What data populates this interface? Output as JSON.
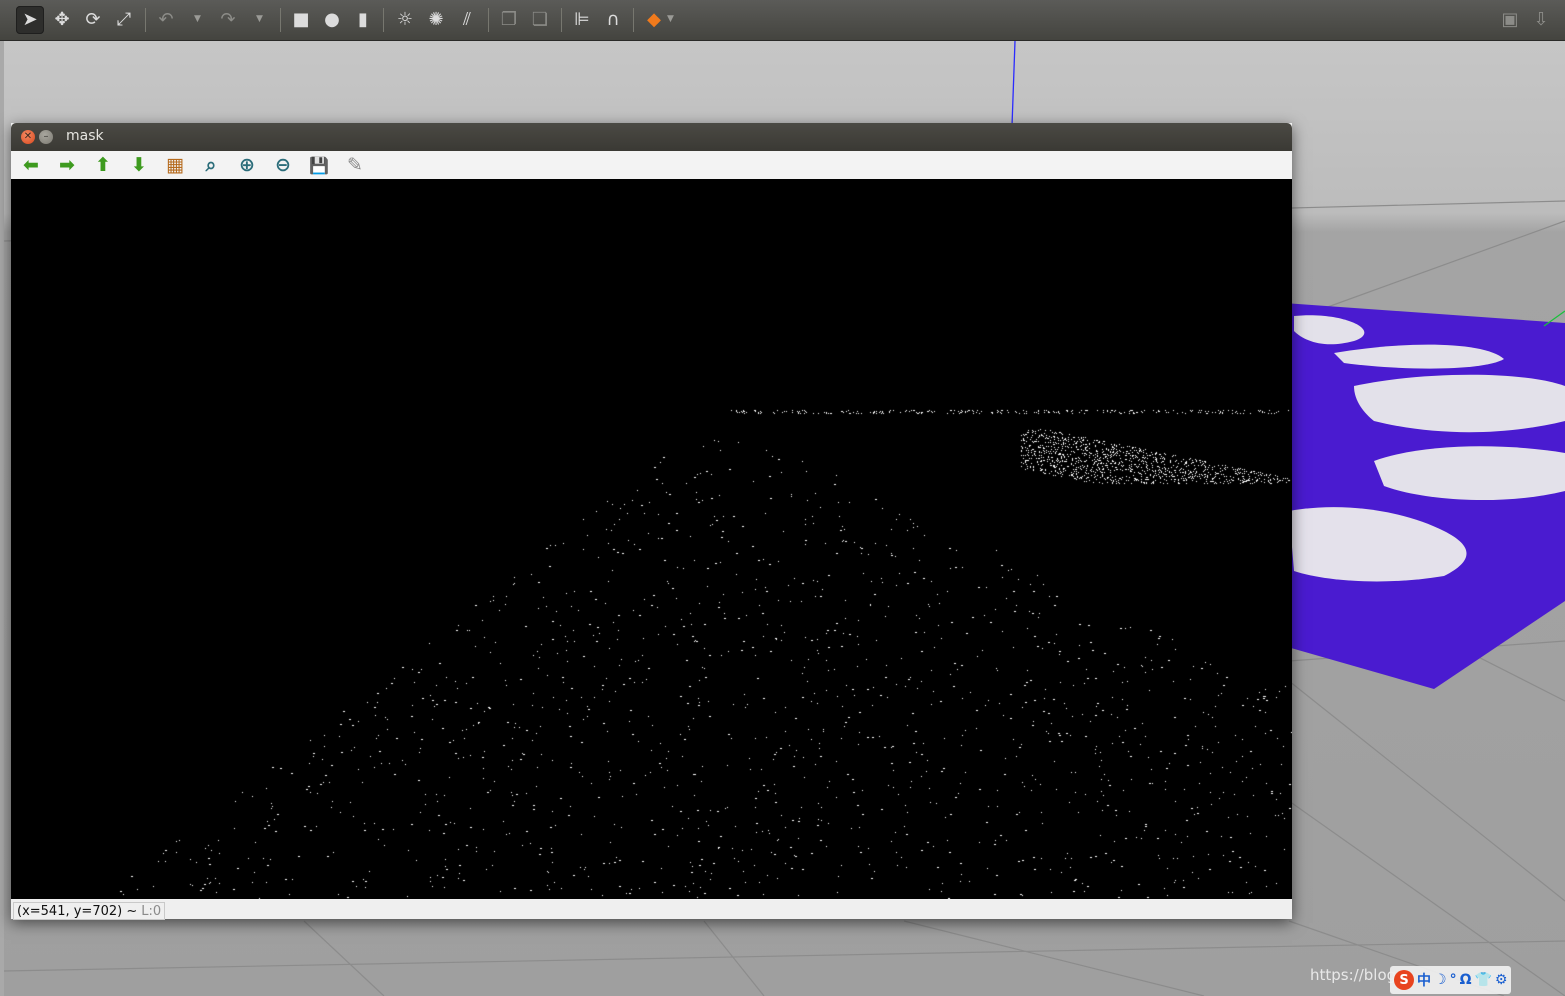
{
  "toolbar": {
    "tools": [
      {
        "name": "select-mode",
        "glyph": "➤"
      },
      {
        "name": "translate-mode",
        "glyph": "✥"
      },
      {
        "name": "rotate-mode",
        "glyph": "⟳"
      },
      {
        "name": "scale-mode",
        "glyph": "⤢"
      },
      {
        "name": "undo",
        "glyph": "↶"
      },
      {
        "name": "redo",
        "glyph": "↷"
      },
      {
        "name": "box-shape",
        "glyph": "■"
      },
      {
        "name": "sphere-shape",
        "glyph": "●"
      },
      {
        "name": "cylinder-shape",
        "glyph": "▮"
      },
      {
        "name": "point-light",
        "glyph": "☼"
      },
      {
        "name": "spot-light",
        "glyph": "✺"
      },
      {
        "name": "directional-light",
        "glyph": "⫽"
      },
      {
        "name": "copy",
        "glyph": "❐"
      },
      {
        "name": "paste",
        "glyph": "❏"
      },
      {
        "name": "align",
        "glyph": "⊫"
      },
      {
        "name": "snap",
        "glyph": "∩"
      },
      {
        "name": "view-angle",
        "glyph": "◆"
      },
      {
        "name": "screenshot",
        "glyph": "▣"
      },
      {
        "name": "log",
        "glyph": "⇩"
      }
    ]
  },
  "mask_window": {
    "title": "mask",
    "toolbar_icons": [
      "pan-left",
      "pan-right",
      "pan-up",
      "pan-down",
      "zoom-image",
      "zoom-fit",
      "zoom-in",
      "zoom-out",
      "save",
      "properties"
    ],
    "toolbar_glyphs": [
      "⬅",
      "➡",
      "⬆",
      "⬇",
      "▦",
      "⌕",
      "⊕",
      "⊖",
      "💾",
      "✎"
    ],
    "status": {
      "coords": "(x=541, y=702) ~",
      "level": "L:0"
    }
  },
  "watermark": {
    "url_text": "https://blog."
  },
  "ime": {
    "logo": "S",
    "items": [
      "中",
      "☽",
      "°",
      "Ω",
      "👕",
      "⚙"
    ]
  },
  "colors": {
    "gazebo_ground_plane": "#4a1bd0",
    "mask_foreground": "#ffffff",
    "mask_background": "#000000"
  }
}
